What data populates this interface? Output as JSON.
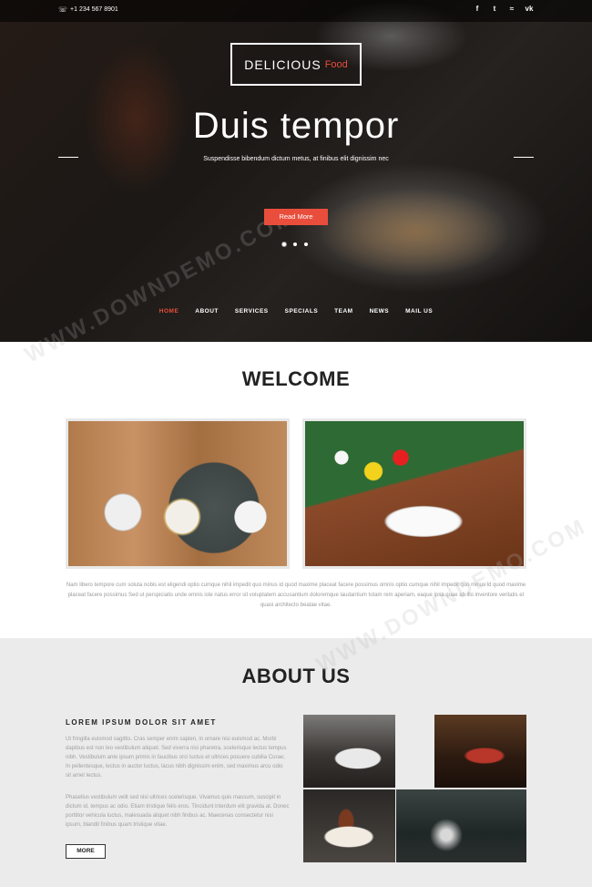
{
  "topbar": {
    "phone": "+1 234 567 8901",
    "socials": [
      {
        "icon": "facebook-icon",
        "glyph": "f"
      },
      {
        "icon": "twitter-icon",
        "glyph": "t"
      },
      {
        "icon": "rss-icon",
        "glyph": "≈"
      },
      {
        "icon": "vk-icon",
        "glyph": "vk"
      }
    ]
  },
  "logo": {
    "main": "DELICIOUS",
    "sub": "Food"
  },
  "hero": {
    "title": "Duis tempor",
    "subtitle": "Suspendisse bibendum dictum metus, at finibus elit dignissim nec",
    "button": "Read More",
    "slides": 3,
    "active_slide": 1
  },
  "nav": {
    "items": [
      "HOME",
      "ABOUT",
      "SERVICES",
      "SPECIALS",
      "TEAM",
      "NEWS",
      "MAIL US"
    ],
    "active": "HOME"
  },
  "welcome": {
    "title": "WELCOME",
    "text": "Nam libero tempore cum soluta nobis est eligendi optio cumque nihil impedit quo minus id quod maxime placeat facere possimus omnis optio cumque nihil impedit quo minus id quod maxime placeat facere possimus Sed ut perspiciatis unde omnis iste natus error sit voluptatem accusantium doloremque laudantium totam rem aperiam, eaque ipsa quae ab illo inventore veritatis et quasi architecto beatae vitae."
  },
  "about": {
    "title": "ABOUT US",
    "heading": "LOREM IPSUM DOLOR SIT AMET",
    "para1": "Ut fringilla euismod sagittis. Cras semper enim sapien, in ornare nisi euismod ac. Morbi dapibus est non leo vestibulum aliquet. Sed viverra nisi pharetra, scelerisque lectus tempus nibh. Vestibulum ante ipsum primis in faucibus orci luctus et ultrices posuere cubilia Curae; In pellentesque, lectus in auctor luctus, lacus nibh dignissim enim, sed maximus arcu odio sit amet lectus.",
    "para2": "Phasellus vestibulum velit sed nisi ultrices scelerisque. Vivamus quis massum, suscipit in dictum id, tempus ac odio. Etiam tristique felis eros. Tincidunt interdum elit gravida at. Donec porttitor vehicula luctus, malesuada aliquet nibh finibus ac. Maecenas consectetur nisi ipsum, blandit finibus quam tristique vitae.",
    "button": "MORE"
  },
  "watermark": "WWW.DOWNDEMO.COM"
}
